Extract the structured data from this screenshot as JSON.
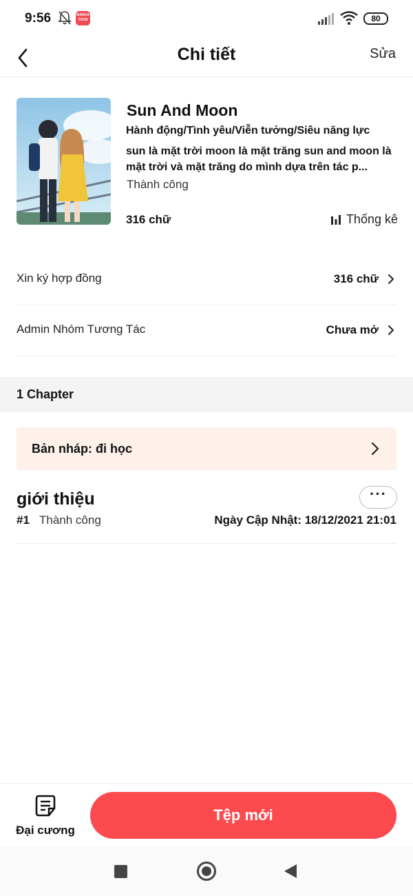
{
  "status_bar": {
    "time": "9:56",
    "app_badge": "MANGA TOON",
    "battery": "80",
    "icons": [
      "bell-off-icon",
      "signal-icon",
      "wifi-icon",
      "battery-icon"
    ]
  },
  "header": {
    "title": "Chi tiết",
    "edit_label": "Sửa",
    "back_icon": "chevron-left-icon"
  },
  "book": {
    "title": "Sun And Moon",
    "genres": "Hành động/Tình yêu/Viễn tưởng/Siêu năng lực",
    "description": "sun là mặt trời moon là mặt trăng sun and moon là mặt trời và mặt trăng do mình dựa trên tác p...",
    "status": "Thành công",
    "word_count": "316 chữ",
    "stats_label": "Thống kê",
    "stats_icon": "bar-chart-icon"
  },
  "rows": [
    {
      "label": "Xin ký hợp đồng",
      "value": "316 chữ"
    },
    {
      "label": "Admin Nhóm Tương Tác",
      "value": "Chưa mở"
    }
  ],
  "section": {
    "title": "1 Chapter"
  },
  "draft": {
    "label": "Bản nháp: đi học"
  },
  "chapter": {
    "title": "giới thiệu",
    "number": "#1",
    "status": "Thành công",
    "updated": "Ngày Cập Nhật: 18/12/2021 21:01",
    "more_label": "···"
  },
  "bottom_bar": {
    "outline_label": "Đại cương",
    "outline_icon": "document-icon",
    "new_file_label": "Tệp mới"
  },
  "colors": {
    "accent": "#fc4a4f",
    "draft_bg": "#fdf1e9",
    "section_bg": "#f4f4f4"
  }
}
